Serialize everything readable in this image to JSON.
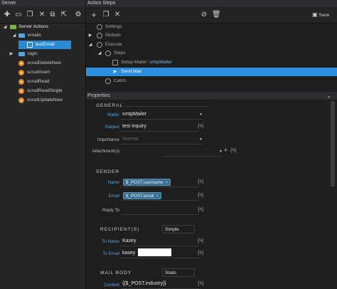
{
  "left_panel": {
    "title": "Server",
    "toolbar": {
      "new_icon": "new-icon",
      "folder_icon": "folder-icon",
      "duplicate_icon": "duplicate-icon",
      "delete_icon": "delete-icon",
      "copy_icon": "copy-icon",
      "paste_icon": "paste-icon",
      "export_icon": "export-icon",
      "settings_icon": "gear-icon"
    },
    "tree": [
      {
        "label": "Server Actions",
        "type": "root",
        "expanded": true
      },
      {
        "label": "emails",
        "type": "folder",
        "expanded": true
      },
      {
        "label": "testEmail",
        "type": "action",
        "selected": true
      },
      {
        "label": "login",
        "type": "folder",
        "expanded": false
      },
      {
        "label": "scrudDeleteNew",
        "type": "action"
      },
      {
        "label": "scrudInsert",
        "type": "action"
      },
      {
        "label": "scrudRead",
        "type": "action"
      },
      {
        "label": "scrudReadSingle",
        "type": "action"
      },
      {
        "label": "scrudUpdateNew",
        "type": "action"
      }
    ]
  },
  "right_panel": {
    "title": "Action Steps",
    "toolbar": {
      "add_icon": "plus-icon",
      "copy_icon": "copy-icon",
      "delete_icon": "delete-icon",
      "disable_icon": "disable-icon",
      "trash_icon": "trash-icon",
      "save_label": "Save"
    },
    "steps": [
      {
        "label": "Settings",
        "expanded": false
      },
      {
        "label": "Globals",
        "expanded": false
      },
      {
        "label": "Execute",
        "expanded": true
      },
      {
        "label": "Steps",
        "expanded": true
      },
      {
        "label": "Setup Mailer: smtpMailer",
        "prefix": "Setup Mailer: ",
        "name": "smtpMailer"
      },
      {
        "label": "Send Mail",
        "selected": true
      },
      {
        "label": "Catch"
      }
    ]
  },
  "properties": {
    "title": "Properties",
    "general": {
      "heading": "GENERAL",
      "mailer_label": "Mailer",
      "mailer_value": "smtpMailer",
      "subject_label": "Subject",
      "subject_value": "test inquiry",
      "importance_label": "Importance",
      "importance_placeholder": "Normal",
      "attachments_label": "Attachment(s)"
    },
    "sender": {
      "heading": "SENDER",
      "name_label": "Name",
      "name_tag": "$_POST.username",
      "email_label": "Email",
      "email_tag": "$_POST.email",
      "reply_label": "Reply To"
    },
    "recipients": {
      "heading": "RECIPIENT(S)",
      "mode": "Simple",
      "to_name_label": "To Name",
      "to_name_value": "Kasey",
      "to_email_label": "To Email",
      "to_email_value": "kasey"
    },
    "mail_body": {
      "heading": "MAIL BODY",
      "mode": "Static",
      "content_label": "Content",
      "content_value": "{{$_POST.industry}}"
    }
  },
  "colors": {
    "accent": "#2d8fe0",
    "label_blue": "#4ea3e8",
    "folder_green": "#7cb342",
    "action_orange": "#e0861f"
  }
}
